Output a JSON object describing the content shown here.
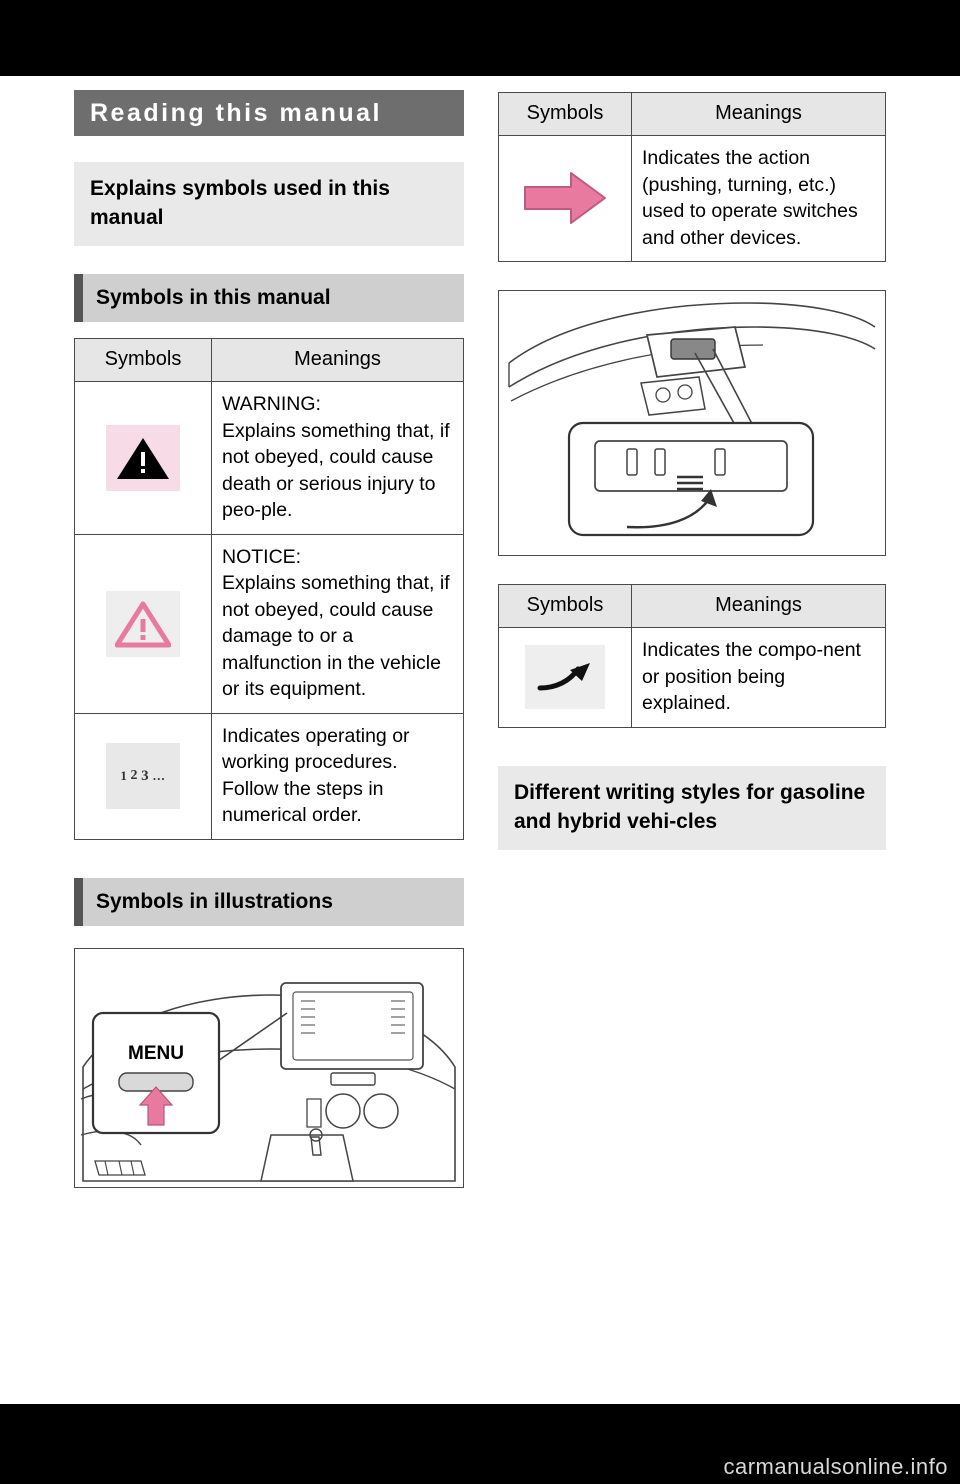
{
  "page": {
    "chapter_title": "Reading this manual",
    "section_head": "Explains symbols used in this manual",
    "subsection_symbols": "Symbols in this manual",
    "subsection_illustrations": "Symbols in illustrations",
    "section_writing_styles": "Different writing styles for gasoline and hybrid vehi-cles",
    "watermark": "carmanualsonline.info"
  },
  "table_left": {
    "header_symbols": "Symbols",
    "header_meanings": "Meanings",
    "rows": [
      {
        "symbol_name": "warning-triangle-icon",
        "meaning": "WARNING:\nExplains something that, if not obeyed, could cause death or serious injury to peo-ple."
      },
      {
        "symbol_name": "notice-triangle-icon",
        "meaning": "NOTICE:\nExplains something that, if not obeyed, could cause damage to or a malfunction in the vehicle or its equipment."
      },
      {
        "symbol_name": "numbered-steps-icon",
        "symbol_text": "1 2 3...",
        "meaning": "Indicates operating or working procedures. Follow the steps in numerical order."
      }
    ]
  },
  "table_right_1": {
    "header_symbols": "Symbols",
    "header_meanings": "Meanings",
    "rows": [
      {
        "symbol_name": "pink-block-arrow-icon",
        "meaning": "Indicates the action (pushing, turning, etc.) used to operate switches and other devices."
      }
    ]
  },
  "table_right_2": {
    "header_symbols": "Symbols",
    "header_meanings": "Meanings",
    "rows": [
      {
        "symbol_name": "black-curved-arrow-icon",
        "meaning": "Indicates the compo-nent or position being explained."
      }
    ]
  },
  "illustration_left": {
    "name": "dashboard-menu-switch-illustration",
    "label": "MENU"
  },
  "illustration_right": {
    "name": "overhead-console-switch-illustration"
  },
  "colors": {
    "chapter_bar": "#6e6e6e",
    "section_head": "#e9e9e9",
    "subsection_head": "#cfcfcf",
    "warning_bg": "#f7dbe6",
    "accent_pink": "#e8799f",
    "table_header": "#e6e6e6",
    "border": "#4a4a4a"
  }
}
